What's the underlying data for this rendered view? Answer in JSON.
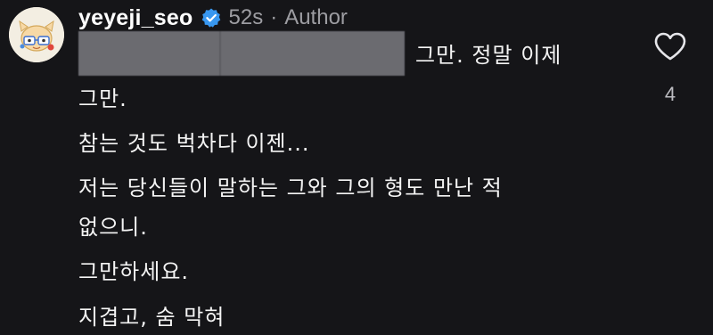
{
  "comment": {
    "username": "yeyeji_seo",
    "timestamp": "52s",
    "separator": "·",
    "role_label": "Author",
    "avatar_icon": "cartoon-avatar-icon",
    "verified_icon": "verified-badge-icon",
    "lines": [
      "그만. 정말 이제",
      "그만.",
      "참는 것도 벅차다 이젠...",
      "저는 당신들이 말하는 그와 그의 형도 만난 적",
      "없으니.",
      "그만하세요.",
      "지겹고, 숨 막혀"
    ],
    "likes": {
      "icon": "heart-outline-icon",
      "count": "4"
    }
  },
  "colors": {
    "background": "#151518",
    "text": "#f4f4f4",
    "muted": "#9d9da2",
    "verified_badge": "#3897f0",
    "redaction": "#6b6b70"
  }
}
